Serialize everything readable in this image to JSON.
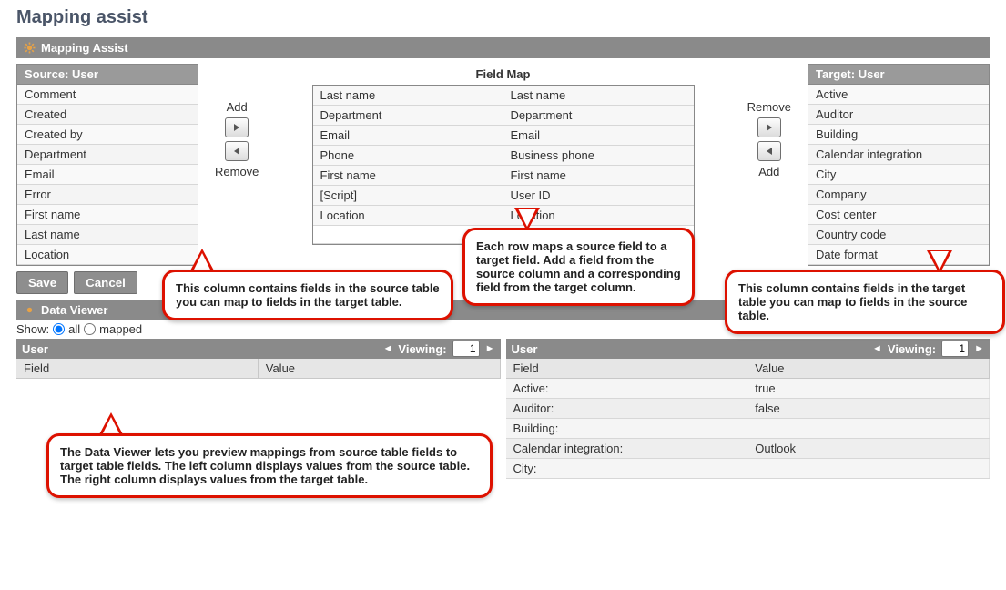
{
  "page_title": "Mapping assist",
  "panel_title": "Mapping Assist",
  "source": {
    "header": "Source: User",
    "fields": [
      "Comment",
      "Created",
      "Created by",
      "Department",
      "Email",
      "Error",
      "First name",
      "Last name",
      "Location"
    ]
  },
  "center": {
    "title": "Field Map",
    "add_label": "Add",
    "remove_label": "Remove",
    "left": [
      "Last name",
      "Department",
      "Email",
      "Phone",
      "First name",
      "[Script]",
      "Location"
    ],
    "right": [
      "Last name",
      "Department",
      "Email",
      "Business phone",
      "First name",
      "User ID",
      "Location"
    ]
  },
  "right_controls": {
    "remove_label": "Remove",
    "add_label": "Add"
  },
  "target": {
    "header": "Target: User",
    "fields": [
      "Active",
      "Auditor",
      "Building",
      "Calendar integration",
      "City",
      "Company",
      "Cost center",
      "Country code",
      "Date format"
    ]
  },
  "buttons": {
    "save": "Save",
    "cancel": "Cancel"
  },
  "viewer": {
    "title": "Data Viewer",
    "show_label": "Show:",
    "opt_all": "all",
    "opt_mapped": "mapped",
    "left": {
      "title": "User",
      "viewing_label": "Viewing:",
      "page": "1",
      "col_field": "Field",
      "col_value": "Value",
      "rows": []
    },
    "right": {
      "title": "User",
      "viewing_label": "Viewing:",
      "page": "1",
      "col_field": "Field",
      "col_value": "Value",
      "rows": [
        {
          "field": "Active:",
          "value": "true"
        },
        {
          "field": "Auditor:",
          "value": "false"
        },
        {
          "field": "Building:",
          "value": ""
        },
        {
          "field": "Calendar integration:",
          "value": "Outlook"
        },
        {
          "field": "City:",
          "value": ""
        }
      ]
    }
  },
  "callouts": {
    "source": "This column contains fields in the source table you can map to fields in the target table.",
    "center": "Each row maps a source field to a target field. Add a field from the source column and a corresponding field from the target column.",
    "target": "This column contains fields in the target table you can map to fields in the source table.",
    "viewer": "The Data Viewer lets you preview mappings from source table fields to target table fields. The left column displays values from the source table. The right column displays values from the target table."
  }
}
